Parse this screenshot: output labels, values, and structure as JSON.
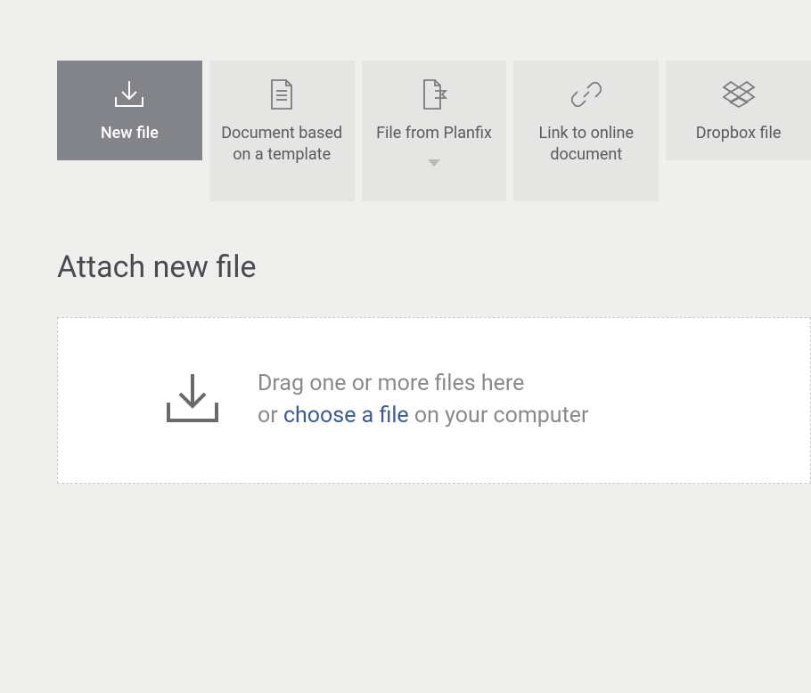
{
  "tabs": [
    {
      "label": "New file"
    },
    {
      "label": "Document based on a template"
    },
    {
      "label": "File from Planfix"
    },
    {
      "label": "Link to online document"
    },
    {
      "label": "Dropbox file"
    }
  ],
  "pageTitle": "Attach new file",
  "dropzone": {
    "line1": "Drag one or more files here",
    "prefix": "or ",
    "link": "choose a file",
    "suffix": " on your computer"
  }
}
